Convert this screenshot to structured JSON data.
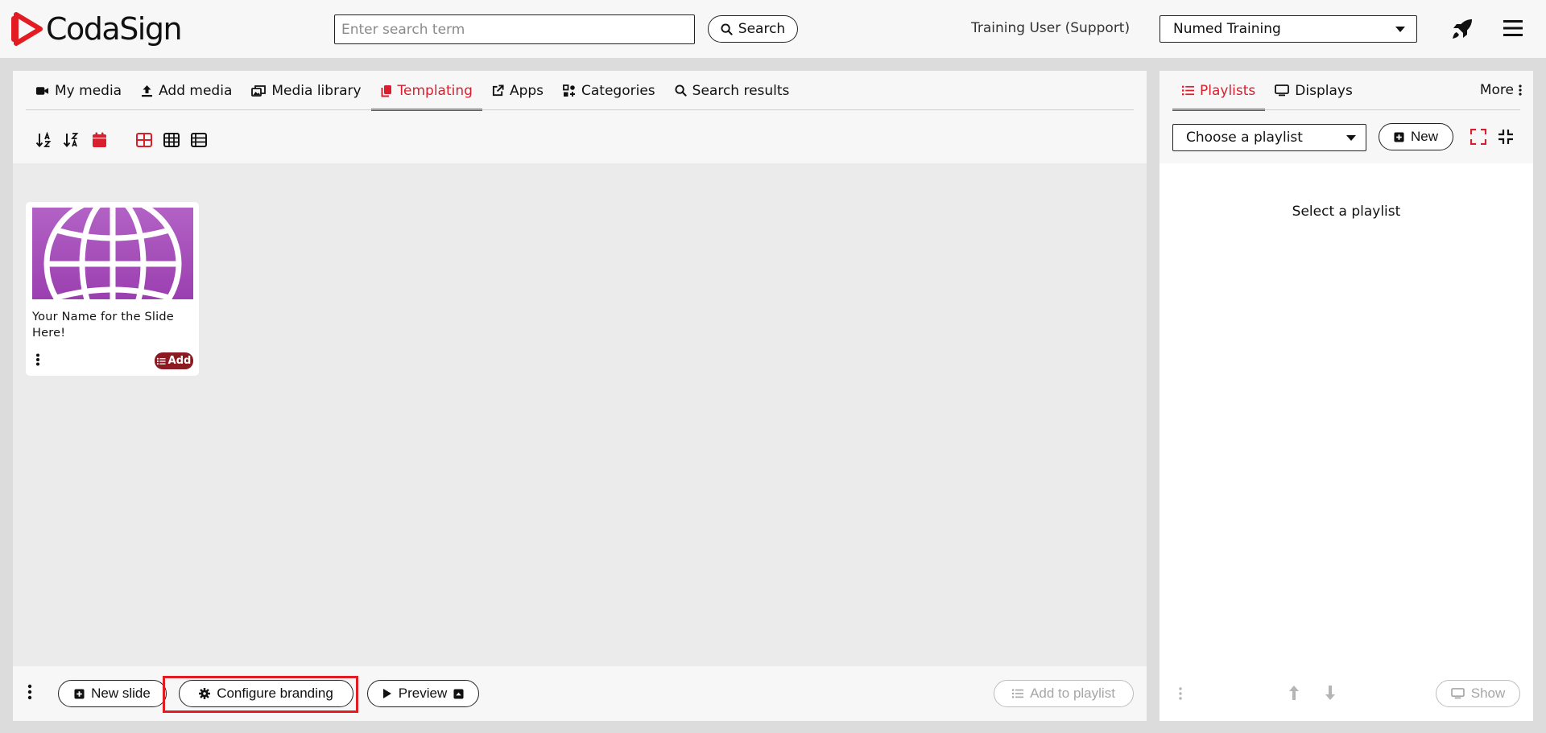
{
  "header": {
    "logo_text": "CodaSign",
    "search_placeholder": "Enter search term",
    "search_button": "Search",
    "user_label": "Training User (Support)",
    "org_select_value": "Numed Training"
  },
  "main": {
    "tabs": [
      {
        "label": "My media",
        "icon": "video-camera-icon"
      },
      {
        "label": "Add media",
        "icon": "upload-icon"
      },
      {
        "label": "Media library",
        "icon": "images-icon"
      },
      {
        "label": "Templating",
        "icon": "copy-icon",
        "active": true
      },
      {
        "label": "Apps",
        "icon": "external-link-icon"
      },
      {
        "label": "Categories",
        "icon": "categories-icon"
      },
      {
        "label": "Search results",
        "icon": "search-icon"
      }
    ],
    "toolbar": {
      "icons": [
        "sort-alpha-asc-icon",
        "sort-alpha-desc-icon",
        "calendar-icon",
        "grid-large-icon",
        "grid-small-icon",
        "list-icon"
      ],
      "active_icons": [
        "calendar-icon",
        "grid-large-icon"
      ]
    },
    "cards": [
      {
        "title": "Your Name for the Slide Here!",
        "add_label": "Add",
        "thumbnail_icon": "globe-icon"
      }
    ],
    "bottom": {
      "new_slide": "New slide",
      "configure_branding": "Configure branding",
      "preview": "Preview",
      "add_to_playlist": "Add to playlist"
    }
  },
  "side": {
    "tabs": [
      {
        "label": "Playlists",
        "icon": "list-icon",
        "active": true
      },
      {
        "label": "Displays",
        "icon": "monitor-icon"
      }
    ],
    "more_label": "More",
    "playlist_placeholder": "Choose a playlist",
    "new_button": "New",
    "empty_message": "Select a playlist",
    "show_button": "Show"
  },
  "colors": {
    "accent": "#d91e2e",
    "badge": "#8b1a22",
    "highlight": "#e31b23",
    "thumbnail": "#a64fbb"
  }
}
